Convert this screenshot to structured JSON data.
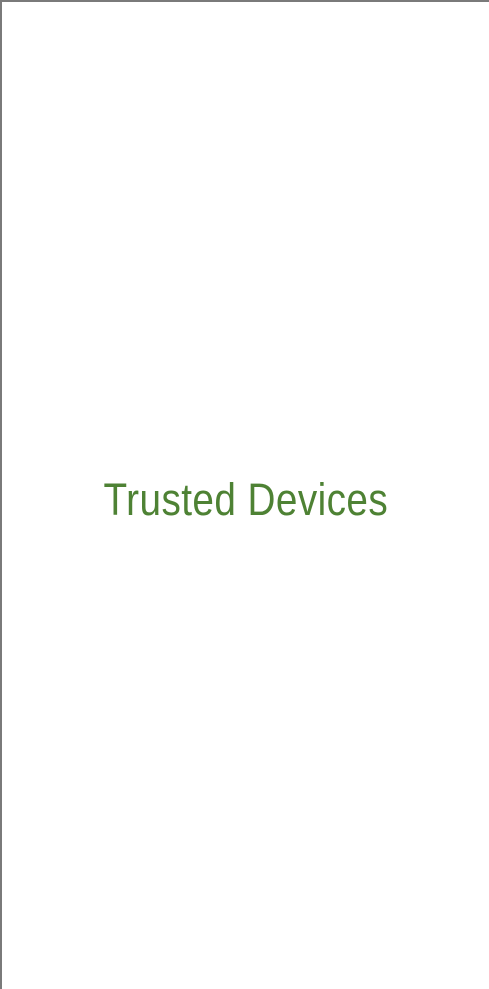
{
  "screen": {
    "title": "Trusted Devices"
  },
  "colors": {
    "title_green": "#4e8234",
    "frame_border": "#7a7a7a",
    "background": "#ffffff"
  }
}
